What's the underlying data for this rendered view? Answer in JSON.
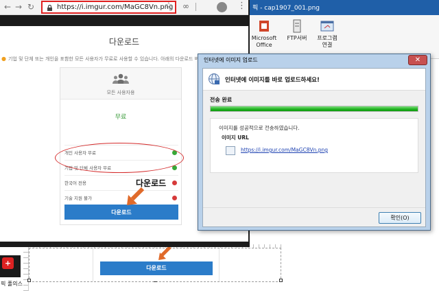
{
  "editor": {
    "title": "픽 - cap1907_001.png",
    "ribbon": [
      {
        "label": "Microsoft\nOffice",
        "icon": "office-icon"
      },
      {
        "label": "FTP서버",
        "icon": "ftp-server-icon"
      },
      {
        "label": "프로그램\n연결",
        "icon": "program-link-icon"
      }
    ],
    "taskbar_label": "픽 풀의스",
    "canvas_button_label": "다운로드"
  },
  "browser": {
    "url": "https://i.imgur.com/MaGC8Vn.png",
    "page_heading": "다운로드",
    "notice": "기업 및 단체 또는 개인을 포함한 모든 사용자가 무료로 사용할 수 있습니다. 아래의 다운로드 버튼을 누르면",
    "plan": {
      "name": "모든 사용자용",
      "price": "무료",
      "features": [
        {
          "label": "개인 사용자 무료",
          "status": "ok"
        },
        {
          "label": "기업 및 단체 사용자 무료",
          "status": "ok"
        },
        {
          "label": "한국어 전용",
          "status": "no"
        },
        {
          "label": "기술 지원 불가",
          "status": "no"
        }
      ]
    },
    "download_label": "다운로드",
    "annotation_label": "다운로드"
  },
  "dialog": {
    "title": "인터넷에 이미지 업로드",
    "close": "✕",
    "headline": "인터넷에 이미지를 바로 업로드하세요!",
    "status": "전송 완료",
    "progress": 1.0,
    "result_message": "이미지를 성공적으로 전송하였습니다.",
    "url_heading": "이미지 URL",
    "image_url": "https://i.imgur.com/MaGC8Vn.png",
    "ok_label": "확인(O)"
  },
  "colors": {
    "accent_blue": "#2b7cc9",
    "annotation_red": "#d42a2a",
    "progress_green": "#1fb01f",
    "ok_green": "#38a838",
    "no_red": "#d63a3a"
  }
}
